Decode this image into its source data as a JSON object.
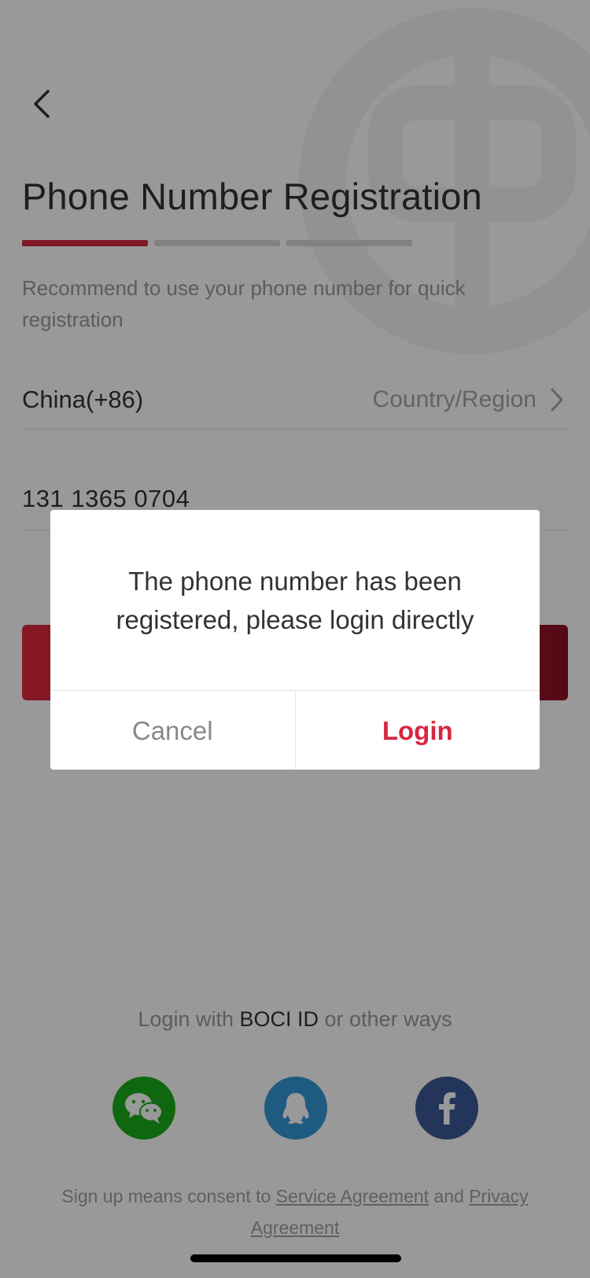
{
  "header": {
    "title": "Phone Number Registration",
    "subtitle": "Recommend to use your phone number for quick registration",
    "steps_total": 3,
    "current_step": 1
  },
  "form": {
    "country_value": "China(+86)",
    "country_label": "Country/Region",
    "phone_value": "131 1365 0704"
  },
  "dialog": {
    "message": "The phone number has been registered, please login directly",
    "cancel_label": "Cancel",
    "login_label": "Login"
  },
  "other_login": {
    "prefix": "Login with ",
    "brand": "BOCI ID",
    "suffix": " or other ways",
    "providers": [
      "wechat-icon",
      "qq-icon",
      "facebook-icon"
    ]
  },
  "consent": {
    "prefix": "Sign up means consent to ",
    "service_link": "Service Agreement",
    "joiner": " and ",
    "privacy_link": "Privacy Agreement"
  },
  "colors": {
    "accent": "#d2283d",
    "wechat": "#1aad19",
    "qq": "#3596d8",
    "facebook": "#3b5998"
  }
}
